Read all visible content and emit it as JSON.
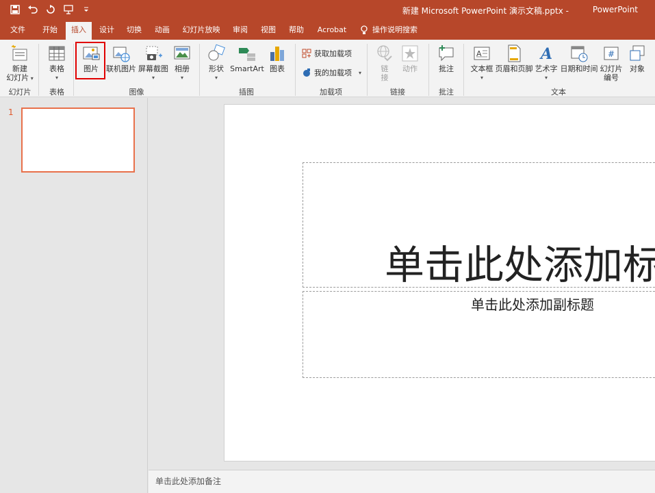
{
  "window": {
    "title": "新建 Microsoft PowerPoint 演示文稿.pptx",
    "app_sep": "-",
    "app": "PowerPoint"
  },
  "tabs": [
    "文件",
    "开始",
    "插入",
    "设计",
    "切换",
    "动画",
    "幻灯片放映",
    "审阅",
    "视图",
    "帮助",
    "Acrobat"
  ],
  "tell_me": "操作说明搜索",
  "ribbon": {
    "new_slide": "新建",
    "new_slide2": "幻灯片",
    "table": "表格",
    "picture": "图片",
    "online_picture": "联机图片",
    "screenshot": "屏幕截图",
    "album": "相册",
    "shapes": "形状",
    "smartart": "SmartArt",
    "chart": "图表",
    "get_addins": "获取加载项",
    "my_addins": "我的加载项",
    "link": "链接",
    "action": "动作",
    "comment": "批注",
    "textbox": "文本框",
    "header_footer": "页眉和页脚",
    "wordart": "艺术字",
    "datetime": "日期和时间",
    "slide_number": "幻灯片",
    "slide_number2": "编号",
    "object": "对象",
    "groups": {
      "slides": "幻灯片",
      "tables": "表格",
      "images": "图像",
      "illustrations": "插图",
      "addins": "加载项",
      "links": "链接",
      "comments": "批注",
      "text": "文本"
    }
  },
  "thumbnails": {
    "slide_number": "1"
  },
  "slide": {
    "title_placeholder": "单击此处添加标",
    "subtitle_placeholder": "单击此处添加副标题"
  },
  "notes": {
    "placeholder": "单击此处添加备注"
  },
  "colors": {
    "accent": "#b7472a",
    "highlight": "#e00000"
  }
}
